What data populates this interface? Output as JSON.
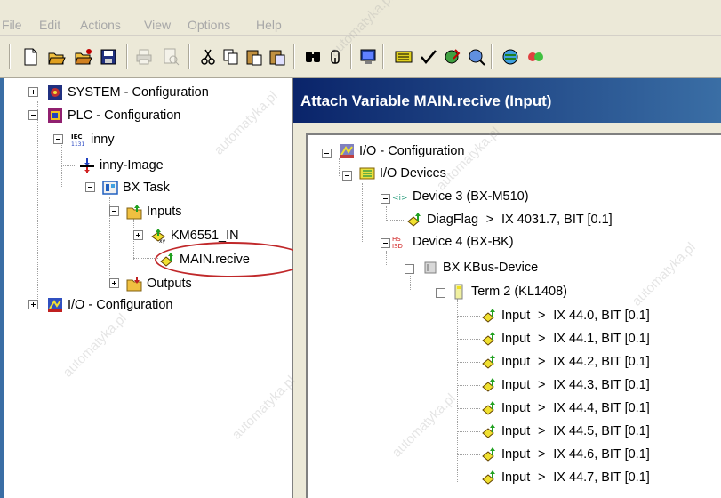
{
  "menu": [
    "File",
    "Edit",
    "Actions",
    "View",
    "Options",
    "Help"
  ],
  "toolbar_icons": [
    "new-icon",
    "open-icon",
    "open-folder-icon",
    "save-icon",
    "print-icon",
    "print-preview-icon",
    "cut-icon",
    "copy-icon",
    "paste-icon",
    "paste-special-icon",
    "find-icon",
    "find-next-icon",
    "monitor-icon",
    "io-icon",
    "check-icon",
    "activate-icon",
    "scan-icon",
    "global-icon",
    "network-icon"
  ],
  "left_tree": {
    "system": "SYSTEM - Configuration",
    "plc": "PLC - Configuration",
    "project": "inny",
    "project_image": "inny-Image",
    "task": "BX Task",
    "inputs": "Inputs",
    "input_struct": "KM6551_IN",
    "selected_var": "MAIN.recive",
    "outputs": "Outputs",
    "io": "I/O - Configuration"
  },
  "dialog": {
    "title": "Attach Variable MAIN.recive (Input)",
    "tree": {
      "root": "I/O - Configuration",
      "devices": "I/O Devices",
      "device3": "Device 3 (BX-M510)",
      "diag_name": "DiagFlag",
      "diag_arrow": ">",
      "diag_addr": "IX 4031.7, BIT [0.1]",
      "device4": "Device 4 (BX-BK)",
      "kbus": "BX KBus-Device",
      "term": "Term 2 (KL1408)",
      "input_label": "Input",
      "arrow": ">",
      "channels": [
        "IX 44.0, BIT [0.1]",
        "IX 44.1, BIT [0.1]",
        "IX 44.2, BIT [0.1]",
        "IX 44.3, BIT [0.1]",
        "IX 44.4, BIT [0.1]",
        "IX 44.5, BIT [0.1]",
        "IX 44.6, BIT [0.1]",
        "IX 44.7, BIT [0.1]"
      ]
    }
  },
  "iec_badge": "IEC",
  "colors": {
    "title_bar_start": "#0a246a",
    "title_bar_end": "#3a6ea5",
    "highlight": "#c0282a",
    "chrome": "#ece9d8"
  }
}
